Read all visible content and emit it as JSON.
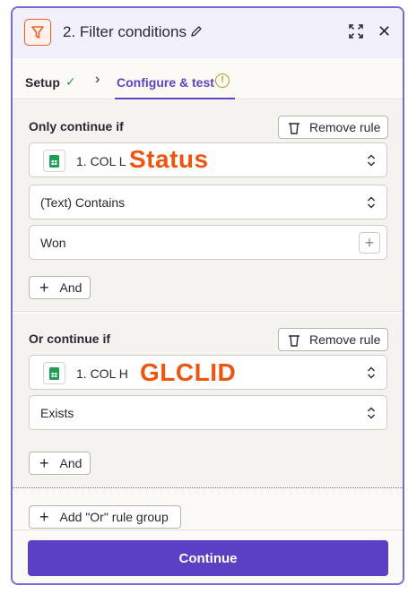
{
  "header": {
    "title": "2. Filter conditions",
    "icons": {
      "step": "filter-icon",
      "edit": "pencil-icon",
      "expand": "expand-icon",
      "close": "close-icon"
    },
    "close_glyph": "✕"
  },
  "tabs": [
    {
      "label": "Setup",
      "status": "check"
    },
    {
      "label": "Configure & test",
      "status": "warning",
      "active": true
    }
  ],
  "warning_glyph": "!",
  "groups": [
    {
      "label": "Only continue if",
      "remove_label": "Remove rule",
      "field": {
        "value": "1. COL L",
        "annotation": "Status"
      },
      "condition": "(Text) Contains",
      "value": "Won",
      "and_label": "And"
    },
    {
      "label": "Or continue if",
      "remove_label": "Remove rule",
      "field": {
        "value": "1. COL H",
        "annotation": "GLCLID"
      },
      "condition": "Exists",
      "and_label": "And"
    }
  ],
  "add_or_label": "Add \"Or\" rule group",
  "continue_label": "Continue",
  "colors": {
    "accent": "#5b3fc4",
    "filter_orange": "#e8622c",
    "annotation": "#ef5411",
    "sheets_green": "#1f9d55"
  }
}
